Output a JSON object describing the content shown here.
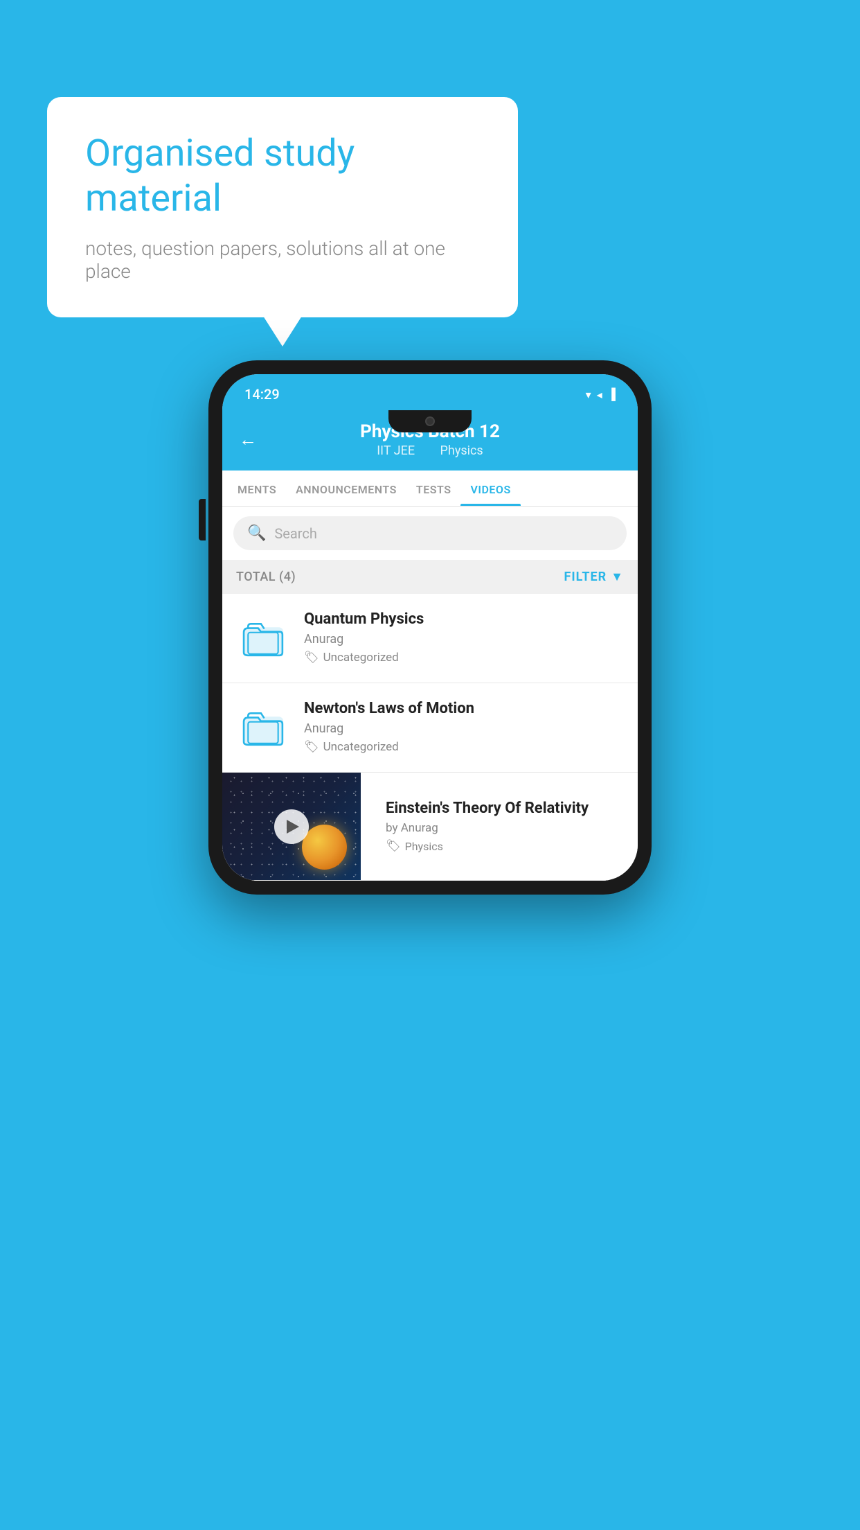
{
  "background_color": "#29B6E8",
  "speech_bubble": {
    "heading": "Organised study material",
    "subtext": "notes, question papers, solutions all at one place"
  },
  "status_bar": {
    "time": "14:29",
    "icons": "▾◂▐"
  },
  "app_header": {
    "back_label": "←",
    "title": "Physics Batch 12",
    "subtitle_course": "IIT JEE",
    "subtitle_subject": "Physics"
  },
  "tabs": [
    {
      "label": "MENTS",
      "active": false
    },
    {
      "label": "ANNOUNCEMENTS",
      "active": false
    },
    {
      "label": "TESTS",
      "active": false
    },
    {
      "label": "VIDEOS",
      "active": true
    }
  ],
  "search": {
    "placeholder": "Search"
  },
  "filter_bar": {
    "total_label": "TOTAL (4)",
    "filter_label": "FILTER"
  },
  "videos": [
    {
      "id": 1,
      "title": "Quantum Physics",
      "author": "Anurag",
      "tag": "Uncategorized",
      "has_thumbnail": false
    },
    {
      "id": 2,
      "title": "Newton's Laws of Motion",
      "author": "Anurag",
      "tag": "Uncategorized",
      "has_thumbnail": false
    },
    {
      "id": 3,
      "title": "Einstein's Theory Of Relativity",
      "author": "by Anurag",
      "tag": "Physics",
      "has_thumbnail": true
    }
  ]
}
